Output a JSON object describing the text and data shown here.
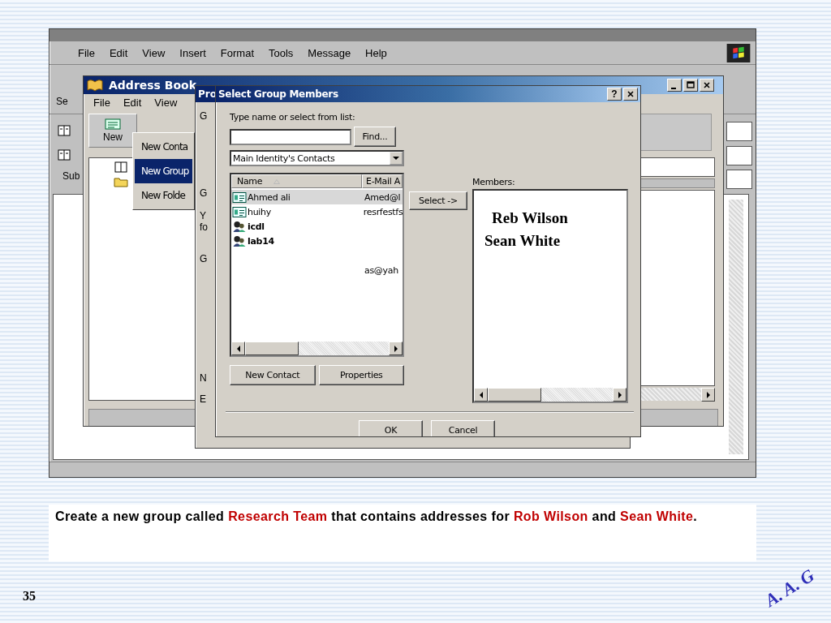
{
  "message_window": {
    "menu": [
      "File",
      "Edit",
      "View",
      "Insert",
      "Format",
      "Tools",
      "Message",
      "Help"
    ],
    "toolbar_label": "Se",
    "field_label": "Sub"
  },
  "address_book": {
    "title": "Address Book",
    "menu": [
      "File",
      "Edit",
      "View"
    ],
    "new_button": "New",
    "new_menu": [
      {
        "label": "New Conta",
        "selected": false
      },
      {
        "label": "New Group",
        "selected": true
      },
      {
        "label": "New Folde",
        "selected": false
      }
    ]
  },
  "properties_dialog": {
    "title": "Pro",
    "edge_letters": [
      "G",
      "G",
      "Y",
      "fo",
      "G",
      "N",
      "E"
    ]
  },
  "select_dialog": {
    "title": "Select Group Members",
    "help_button": "?",
    "prompt": "Type name or select from list:",
    "find_button": "Find...",
    "source": "Main Identity's Contacts",
    "columns": [
      "Name",
      "E-Mail A"
    ],
    "rows": [
      {
        "kind": "contact",
        "name": "Ahmed ali",
        "email": "Amed@l",
        "selected": true
      },
      {
        "kind": "contact",
        "name": "huihy",
        "email": "resrfestfs",
        "selected": false
      },
      {
        "kind": "group",
        "name": "icdl",
        "selected": false
      },
      {
        "kind": "group",
        "name": "lab14",
        "selected": false
      },
      {
        "kind": "blank",
        "email": "as@yah",
        "selected": false
      }
    ],
    "select_button": "Select ->",
    "members_label": "Members:",
    "members": [
      "Reb Wilson",
      "Sean White"
    ],
    "new_contact_button": "New Contact",
    "properties_button": "Properties",
    "ok_button": "OK",
    "cancel_button": "Cancel"
  },
  "slide": {
    "caption": [
      {
        "text": "Create a new group called ",
        "highlight": false
      },
      {
        "text": "Research Team",
        "highlight": true
      },
      {
        "text": " that contains addresses for ",
        "highlight": false
      },
      {
        "text": "Rob Wilson",
        "highlight": true
      },
      {
        "text": " and ",
        "highlight": false
      },
      {
        "text": "Sean White",
        "highlight": true
      },
      {
        "text": ".",
        "highlight": false
      }
    ],
    "page_number": "35",
    "signature": "A. A. G"
  }
}
